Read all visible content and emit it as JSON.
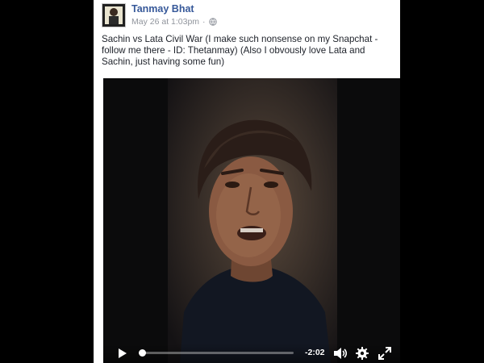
{
  "post": {
    "author": "Tanmay Bhat",
    "timestamp": "May 26 at 1:03pm",
    "separator": "·",
    "privacy_icon": "globe-icon",
    "text": "Sachin vs Lata Civil War (I make such nonsense on my Snapchat - follow me there - ID: Thetanmay) (Also I obvously love Lata and Sachin, just having some fun)",
    "author_link_color": "#365899"
  },
  "video": {
    "time_remaining": "-2:02",
    "progress": 0.02,
    "icons": [
      "play-icon",
      "volume-icon",
      "settings-gear-icon",
      "fullscreen-icon"
    ]
  }
}
